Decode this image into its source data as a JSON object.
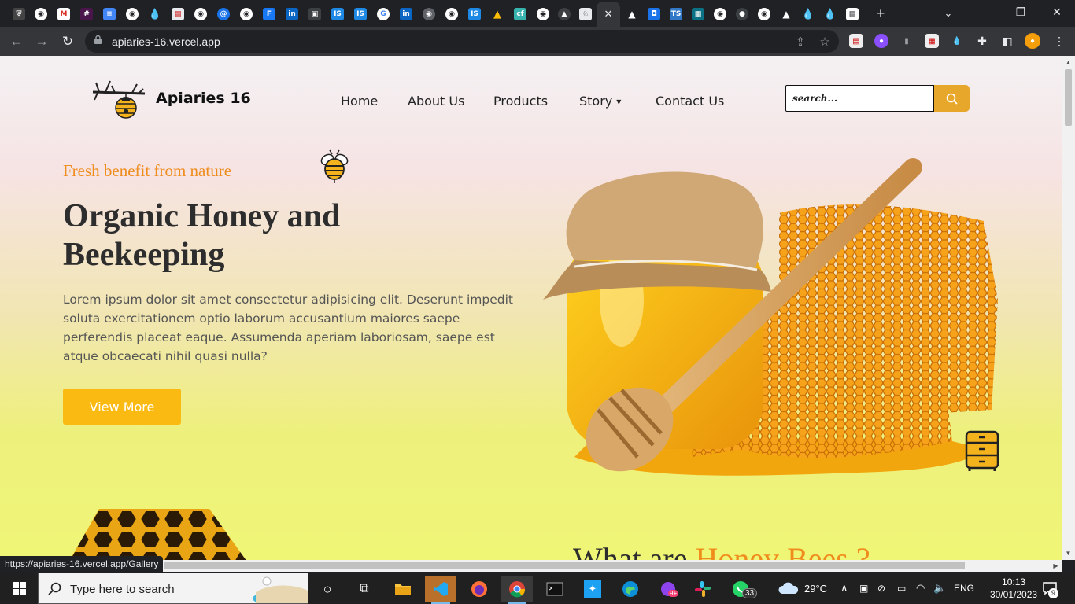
{
  "browser": {
    "new_tab_label": "+",
    "url": "apiaries-16.vercel.app",
    "status_url": "https://apiaries-16.vercel.app/Gallery",
    "tab_close_glyph": "✕"
  },
  "site": {
    "brand": "Apiaries 16",
    "nav": [
      "Home",
      "About Us",
      "Products",
      "Story",
      "Contact Us"
    ],
    "search_placeholder": "search...",
    "hero": {
      "tagline": "Fresh benefit from nature",
      "title": "Organic Honey and Beekeeping",
      "text": "Lorem ipsum dolor sit amet consectetur adipisicing elit. Deserunt impedit soluta exercitationem optio laborum accusantium maiores saepe perferendis placeat eaque. Assumenda aperiam laboriosam, saepe est atque obcaecati nihil quasi nulla?",
      "button": "View More"
    },
    "section_title_prefix": "What are ",
    "section_title_highlight": "Honey Bees ?"
  },
  "taskbar": {
    "search_placeholder": "Type here to search",
    "weather": "29°C",
    "language": "ENG",
    "time": "10:13",
    "date": "30/01/2023",
    "whatsapp_badge": "33",
    "notification_badge": "9",
    "messenger_badge": "9+"
  },
  "colors": {
    "accent": "#fbba12",
    "tagline": "#f08c1c",
    "search_button": "#e7a72a"
  }
}
